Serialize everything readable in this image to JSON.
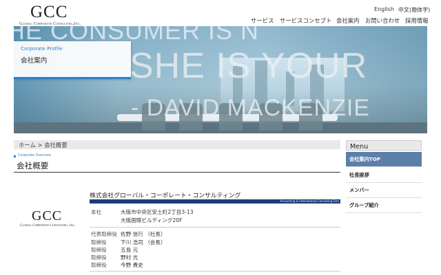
{
  "header": {
    "logo": "GCC",
    "logo_sub": "Global Corporate Consulting,Inc.",
    "lang_en": "English",
    "lang_zh": "中文(簡体字)",
    "nav": [
      "サービス",
      "サービスコンセプト",
      "会社案内",
      "お問い合わせ",
      "採用情報"
    ]
  },
  "hero": {
    "text_line1": "HE CONSUMER IS N",
    "text_line2": "SHE IS YOUR",
    "text_line3": "- DAVID MACKENZIE",
    "box_en": "Corporate Profile",
    "box_jp": "会社案内"
  },
  "breadcrumb": "ホーム > 会社概要",
  "section": {
    "en": "Corporate Overview",
    "title": "会社概要"
  },
  "company": {
    "logo": "GCC",
    "logo_sub": "Global Corporate Consulting, Inc.",
    "name": "株式会社グローバル・コーポレート・コンサルティング",
    "bar_text": "Accounting & International Consulting Firm",
    "address_label": "本社",
    "address_line1": "大阪市中央区安土町2丁目3-13",
    "address_line2": "大阪国際ビルディング20F",
    "officers": [
      {
        "role": "代表取締役",
        "name": "佐野 信行 （社長）"
      },
      {
        "role": "取締役",
        "name": "下川 浩司 （会長）"
      },
      {
        "role": "取締役",
        "name": "五島 元"
      },
      {
        "role": "取締役",
        "name": "野村 光"
      },
      {
        "role": "取締役",
        "name": "今野 貴史"
      }
    ]
  },
  "menu": {
    "title": "Menu",
    "items": [
      "会社案内TOP",
      "社長挨拶",
      "メンバー",
      "グループ紹介"
    ],
    "active_index": 0
  },
  "colors": {
    "accent": "#2d7fc8",
    "navy_bar": "#1b3c77",
    "menu_active": "#5b7fa8"
  }
}
